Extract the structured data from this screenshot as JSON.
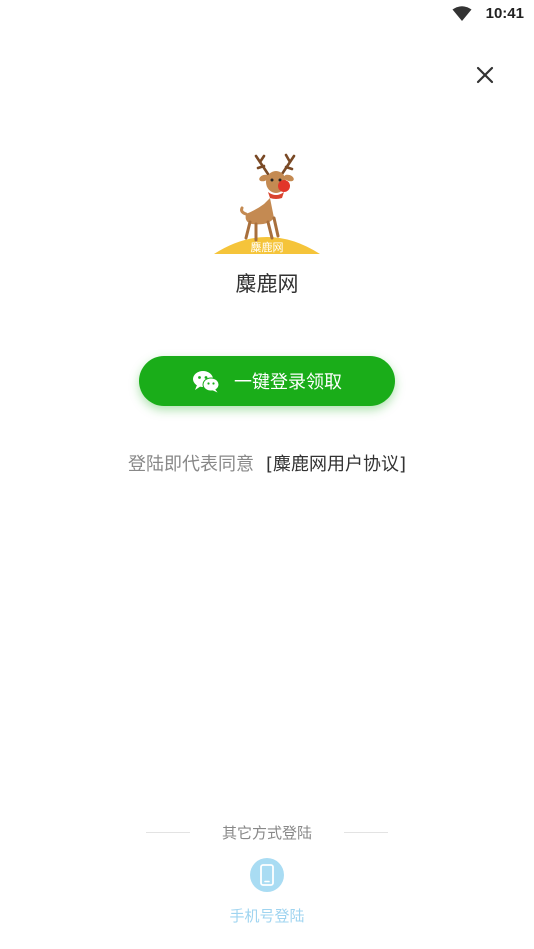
{
  "status_bar": {
    "time": "10:41",
    "wifi_icon": "wifi-icon"
  },
  "header": {
    "close_icon": "close-icon"
  },
  "app": {
    "name": "麋鹿网",
    "logo_text": "麋鹿网",
    "logo_icon": "deer-logo-icon"
  },
  "login": {
    "wechat_button_label": "一键登录领取",
    "wechat_icon": "wechat-icon"
  },
  "agreement": {
    "prefix": "登陆即代表同意",
    "link": "[麋鹿网用户协议]"
  },
  "other_login": {
    "title": "其它方式登陆",
    "phone_label": "手机号登陆",
    "phone_icon": "phone-icon"
  },
  "colors": {
    "primary_green": "#1aad19",
    "phone_blue": "#a9dcf3",
    "logo_yellow": "#f5c43a",
    "deer_brown": "#b7804a"
  }
}
